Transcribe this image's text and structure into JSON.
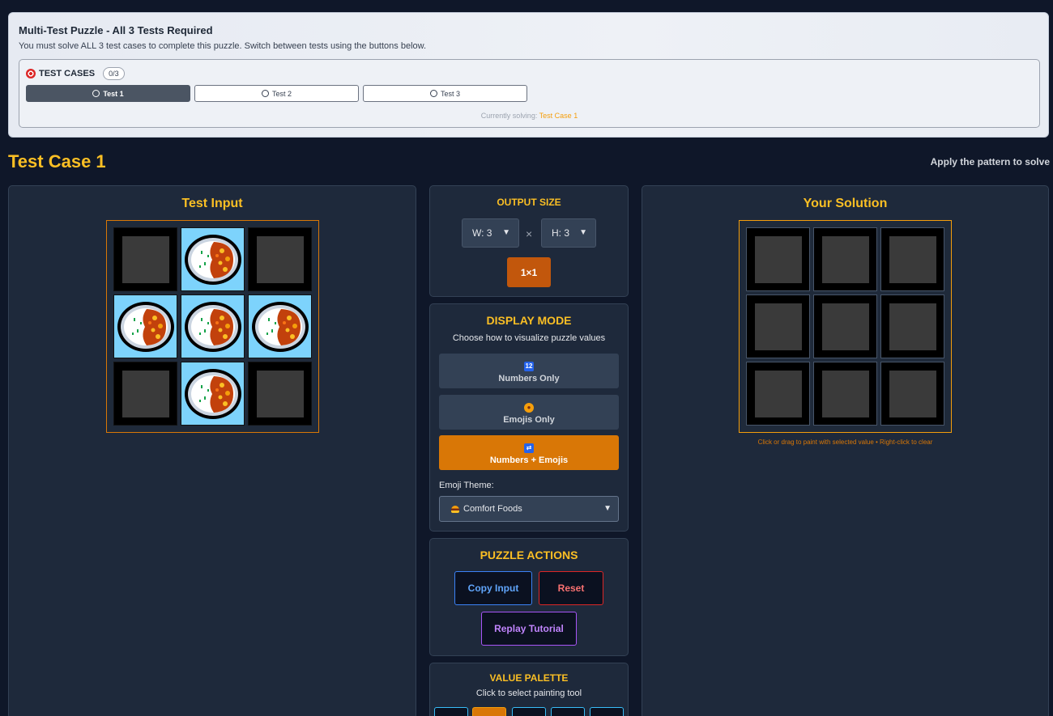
{
  "banner": {
    "title": "Multi-Test Puzzle - All 3 Tests Required",
    "description": "You must solve ALL 3 test cases to complete this puzzle. Switch between tests using the buttons below.",
    "test_cases_label": "TEST CASES",
    "progress_badge": "0/3",
    "tests": [
      {
        "label": "Test 1",
        "active": true
      },
      {
        "label": "Test 2",
        "active": false
      },
      {
        "label": "Test 3",
        "active": false
      }
    ],
    "currently_solving_label": "Currently solving:",
    "currently_solving_value": "Test Case 1"
  },
  "case": {
    "title": "Test Case 1",
    "hint": "Apply the pattern to solve"
  },
  "test_input": {
    "title": "Test Input",
    "grid": [
      [
        "empty",
        "food",
        "empty"
      ],
      [
        "food",
        "food",
        "food"
      ],
      [
        "empty",
        "food",
        "empty"
      ]
    ]
  },
  "output_size": {
    "title": "OUTPUT SIZE",
    "width": "W: 3",
    "height": "H: 3",
    "times": "×",
    "resize_button": "1×1"
  },
  "display_mode": {
    "title": "DISPLAY MODE",
    "subtitle": "Choose how to visualize puzzle values",
    "options": [
      {
        "label": "Numbers Only",
        "icon": "numbers-icon",
        "active": false
      },
      {
        "label": "Emojis Only",
        "icon": "palette-icon",
        "active": false
      },
      {
        "label": "Numbers + Emojis",
        "icon": "shuffle-icon",
        "active": true
      }
    ],
    "theme_label": "Emoji Theme:",
    "theme_value": "Comfort Foods"
  },
  "puzzle_actions": {
    "title": "PUZZLE ACTIONS",
    "copy_input": "Copy Input",
    "reset": "Reset",
    "replay_tutorial": "Replay Tutorial"
  },
  "value_palette": {
    "title": "VALUE PALETTE",
    "subtitle": "Click to select painting tool",
    "selected_index": 1
  },
  "solution": {
    "title": "Your Solution",
    "note": "Click or drag to paint with selected value • Right-click to clear",
    "grid": [
      [
        "empty",
        "empty",
        "empty"
      ],
      [
        "empty",
        "empty",
        "empty"
      ],
      [
        "empty",
        "empty",
        "empty"
      ]
    ]
  }
}
